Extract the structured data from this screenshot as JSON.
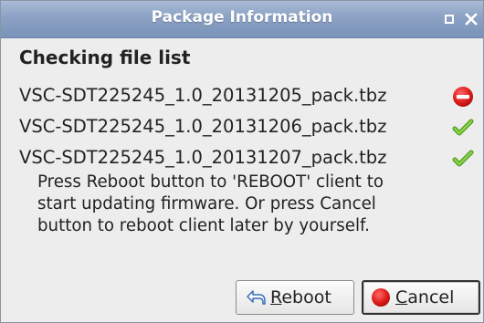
{
  "window": {
    "title": "Package Information",
    "controls": {
      "maximize_icon": "maximize-icon",
      "close_icon": "close-icon"
    }
  },
  "heading": "Checking file list",
  "files": [
    {
      "name": "VSC-SDT225245_1.0_20131205_pack.tbz",
      "status": "error",
      "icon": "error-icon"
    },
    {
      "name": "VSC-SDT225245_1.0_20131206_pack.tbz",
      "status": "ok",
      "icon": "check-icon"
    },
    {
      "name": "VSC-SDT225245_1.0_20131207_pack.tbz",
      "status": "ok",
      "icon": "check-icon"
    }
  ],
  "message": {
    "line1": "Press Reboot button to 'REBOOT' client to",
    "line2": "start updating firmware. Or press Cancel",
    "line3": "button to reboot client later by yourself."
  },
  "buttons": {
    "reboot": {
      "mnemonic": "R",
      "rest": "eboot",
      "icon": "undo-arrow-icon"
    },
    "cancel": {
      "mnemonic": "C",
      "rest": "ancel",
      "icon": "cancel-icon"
    }
  },
  "colors": {
    "titlebar": "#8ba1c4",
    "error_red": "#e02020",
    "ok_green": "#6bbf2a"
  }
}
